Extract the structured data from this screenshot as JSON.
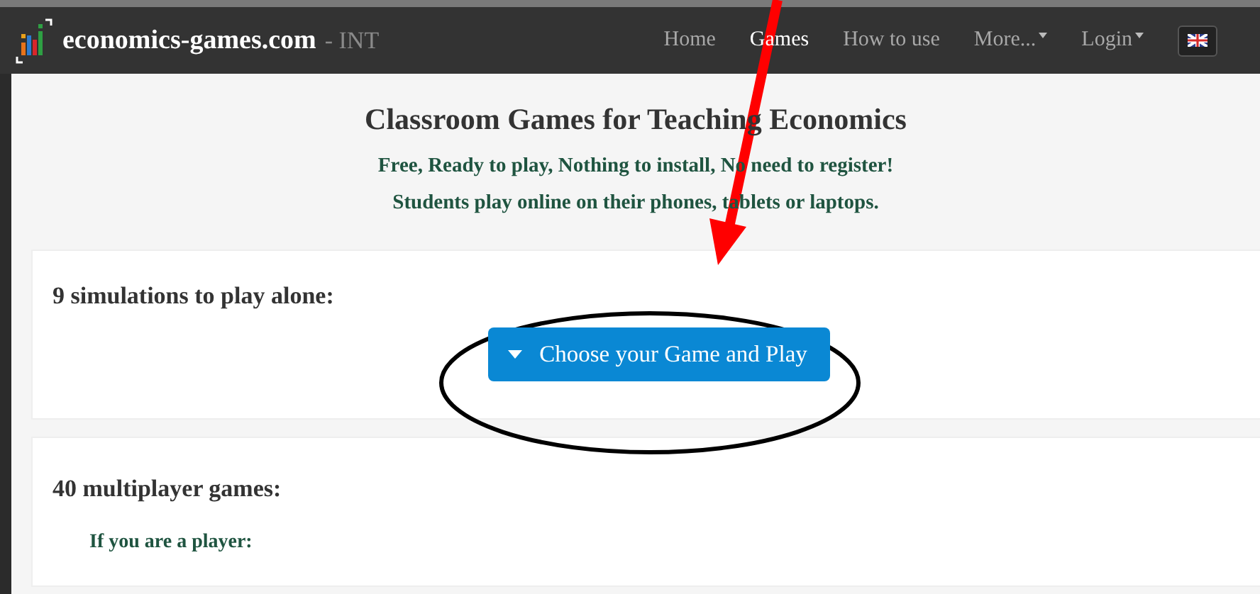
{
  "navbar": {
    "brand": "economics-games.com",
    "brand_suffix": "- INT",
    "items": [
      {
        "label": "Home",
        "selected": false,
        "dropdown": false
      },
      {
        "label": "Games",
        "selected": true,
        "dropdown": false
      },
      {
        "label": "How to use",
        "selected": false,
        "dropdown": false
      },
      {
        "label": "More...",
        "selected": false,
        "dropdown": true
      },
      {
        "label": "Login",
        "selected": false,
        "dropdown": true
      }
    ]
  },
  "header": {
    "title": "Classroom Games for Teaching Economics",
    "lines": [
      "Free, Ready to play, Nothing to install, No need to register!",
      "Students play online on their phones, tablets or laptops."
    ]
  },
  "sections": [
    {
      "heading": "9 simulations to play alone:",
      "button": "Choose your Game and Play"
    },
    {
      "heading": "40 multiplayer games:",
      "subheading": "If you are a player:"
    }
  ]
}
